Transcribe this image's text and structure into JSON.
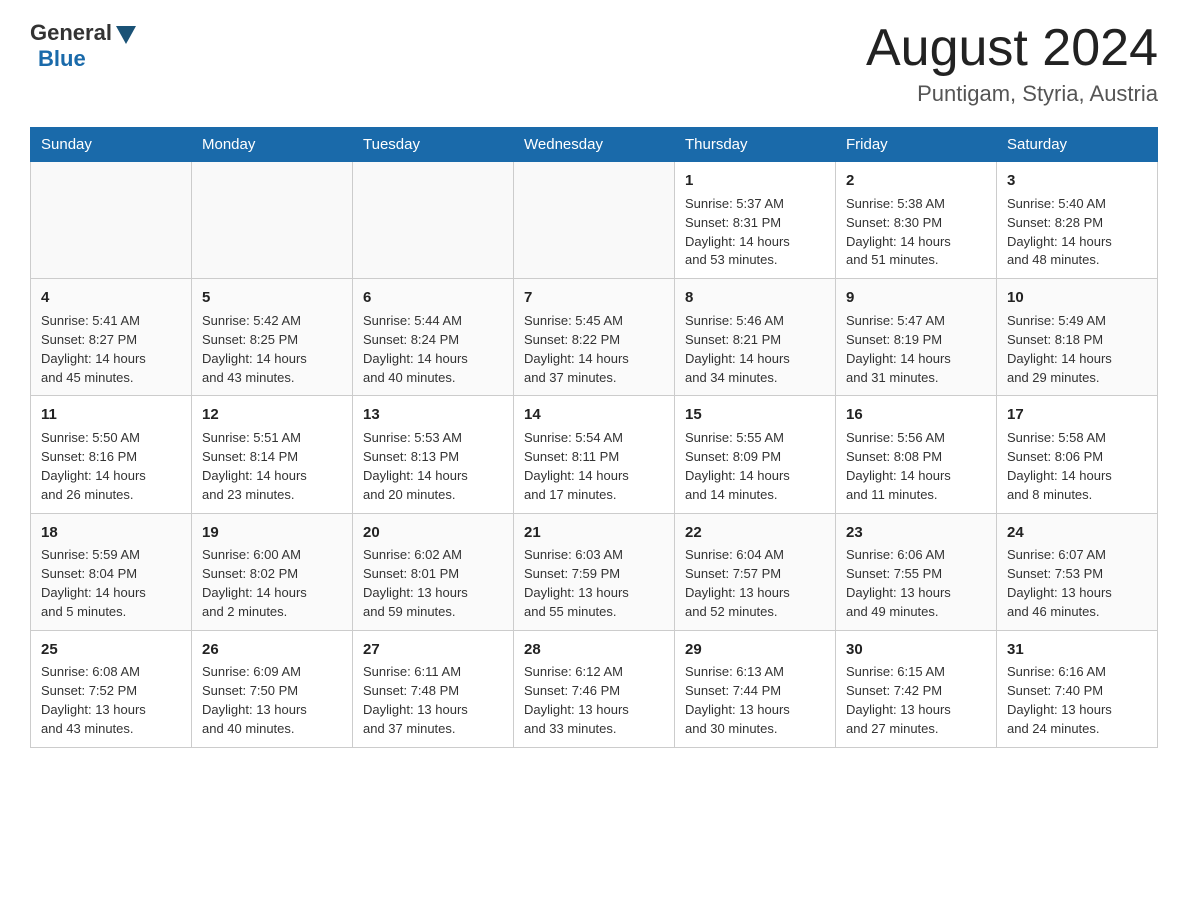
{
  "header": {
    "logo_general": "General",
    "logo_blue": "Blue",
    "month_year": "August 2024",
    "location": "Puntigam, Styria, Austria"
  },
  "weekdays": [
    "Sunday",
    "Monday",
    "Tuesday",
    "Wednesday",
    "Thursday",
    "Friday",
    "Saturday"
  ],
  "weeks": [
    [
      {
        "day": "",
        "info": ""
      },
      {
        "day": "",
        "info": ""
      },
      {
        "day": "",
        "info": ""
      },
      {
        "day": "",
        "info": ""
      },
      {
        "day": "1",
        "info": "Sunrise: 5:37 AM\nSunset: 8:31 PM\nDaylight: 14 hours\nand 53 minutes."
      },
      {
        "day": "2",
        "info": "Sunrise: 5:38 AM\nSunset: 8:30 PM\nDaylight: 14 hours\nand 51 minutes."
      },
      {
        "day": "3",
        "info": "Sunrise: 5:40 AM\nSunset: 8:28 PM\nDaylight: 14 hours\nand 48 minutes."
      }
    ],
    [
      {
        "day": "4",
        "info": "Sunrise: 5:41 AM\nSunset: 8:27 PM\nDaylight: 14 hours\nand 45 minutes."
      },
      {
        "day": "5",
        "info": "Sunrise: 5:42 AM\nSunset: 8:25 PM\nDaylight: 14 hours\nand 43 minutes."
      },
      {
        "day": "6",
        "info": "Sunrise: 5:44 AM\nSunset: 8:24 PM\nDaylight: 14 hours\nand 40 minutes."
      },
      {
        "day": "7",
        "info": "Sunrise: 5:45 AM\nSunset: 8:22 PM\nDaylight: 14 hours\nand 37 minutes."
      },
      {
        "day": "8",
        "info": "Sunrise: 5:46 AM\nSunset: 8:21 PM\nDaylight: 14 hours\nand 34 minutes."
      },
      {
        "day": "9",
        "info": "Sunrise: 5:47 AM\nSunset: 8:19 PM\nDaylight: 14 hours\nand 31 minutes."
      },
      {
        "day": "10",
        "info": "Sunrise: 5:49 AM\nSunset: 8:18 PM\nDaylight: 14 hours\nand 29 minutes."
      }
    ],
    [
      {
        "day": "11",
        "info": "Sunrise: 5:50 AM\nSunset: 8:16 PM\nDaylight: 14 hours\nand 26 minutes."
      },
      {
        "day": "12",
        "info": "Sunrise: 5:51 AM\nSunset: 8:14 PM\nDaylight: 14 hours\nand 23 minutes."
      },
      {
        "day": "13",
        "info": "Sunrise: 5:53 AM\nSunset: 8:13 PM\nDaylight: 14 hours\nand 20 minutes."
      },
      {
        "day": "14",
        "info": "Sunrise: 5:54 AM\nSunset: 8:11 PM\nDaylight: 14 hours\nand 17 minutes."
      },
      {
        "day": "15",
        "info": "Sunrise: 5:55 AM\nSunset: 8:09 PM\nDaylight: 14 hours\nand 14 minutes."
      },
      {
        "day": "16",
        "info": "Sunrise: 5:56 AM\nSunset: 8:08 PM\nDaylight: 14 hours\nand 11 minutes."
      },
      {
        "day": "17",
        "info": "Sunrise: 5:58 AM\nSunset: 8:06 PM\nDaylight: 14 hours\nand 8 minutes."
      }
    ],
    [
      {
        "day": "18",
        "info": "Sunrise: 5:59 AM\nSunset: 8:04 PM\nDaylight: 14 hours\nand 5 minutes."
      },
      {
        "day": "19",
        "info": "Sunrise: 6:00 AM\nSunset: 8:02 PM\nDaylight: 14 hours\nand 2 minutes."
      },
      {
        "day": "20",
        "info": "Sunrise: 6:02 AM\nSunset: 8:01 PM\nDaylight: 13 hours\nand 59 minutes."
      },
      {
        "day": "21",
        "info": "Sunrise: 6:03 AM\nSunset: 7:59 PM\nDaylight: 13 hours\nand 55 minutes."
      },
      {
        "day": "22",
        "info": "Sunrise: 6:04 AM\nSunset: 7:57 PM\nDaylight: 13 hours\nand 52 minutes."
      },
      {
        "day": "23",
        "info": "Sunrise: 6:06 AM\nSunset: 7:55 PM\nDaylight: 13 hours\nand 49 minutes."
      },
      {
        "day": "24",
        "info": "Sunrise: 6:07 AM\nSunset: 7:53 PM\nDaylight: 13 hours\nand 46 minutes."
      }
    ],
    [
      {
        "day": "25",
        "info": "Sunrise: 6:08 AM\nSunset: 7:52 PM\nDaylight: 13 hours\nand 43 minutes."
      },
      {
        "day": "26",
        "info": "Sunrise: 6:09 AM\nSunset: 7:50 PM\nDaylight: 13 hours\nand 40 minutes."
      },
      {
        "day": "27",
        "info": "Sunrise: 6:11 AM\nSunset: 7:48 PM\nDaylight: 13 hours\nand 37 minutes."
      },
      {
        "day": "28",
        "info": "Sunrise: 6:12 AM\nSunset: 7:46 PM\nDaylight: 13 hours\nand 33 minutes."
      },
      {
        "day": "29",
        "info": "Sunrise: 6:13 AM\nSunset: 7:44 PM\nDaylight: 13 hours\nand 30 minutes."
      },
      {
        "day": "30",
        "info": "Sunrise: 6:15 AM\nSunset: 7:42 PM\nDaylight: 13 hours\nand 27 minutes."
      },
      {
        "day": "31",
        "info": "Sunrise: 6:16 AM\nSunset: 7:40 PM\nDaylight: 13 hours\nand 24 minutes."
      }
    ]
  ]
}
